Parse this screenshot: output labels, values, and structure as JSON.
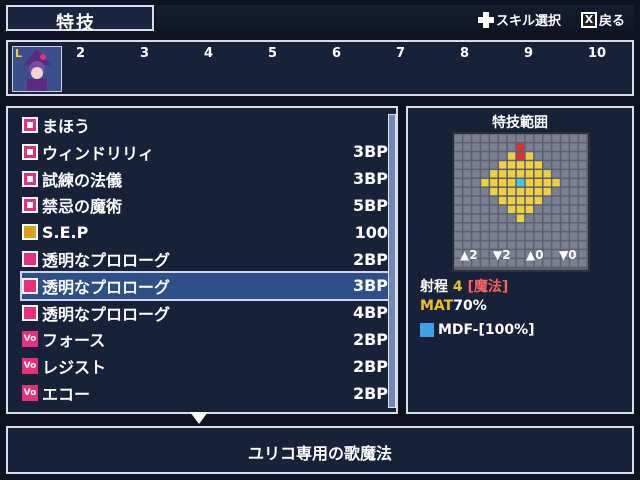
{
  "header": {
    "title": "特技",
    "hint_select": "スキル選択",
    "hint_back": "戻る",
    "hint_back_key": "X"
  },
  "party": {
    "leader_badge": "L",
    "slots": [
      "2",
      "3",
      "4",
      "5",
      "6",
      "7",
      "8",
      "9",
      "10"
    ]
  },
  "skills": [
    {
      "name": "まほう",
      "cost": "",
      "icon": "pink-square-icon"
    },
    {
      "name": "ウィンドリリィ",
      "cost": "3BP",
      "icon": "pink-square-icon"
    },
    {
      "name": "試練の法儀",
      "cost": "3BP",
      "icon": "pink-square-icon"
    },
    {
      "name": "禁忌の魔術",
      "cost": "5BP",
      "icon": "pink-square-icon"
    },
    {
      "name": "S.E.P",
      "cost": "100",
      "icon": "gold-pattern-icon"
    },
    {
      "name": "透明なプロローグ",
      "cost": "2BP",
      "icon": "music-note-icon"
    },
    {
      "name": "透明なプロローグ",
      "cost": "3BP",
      "icon": "music-note-plus-icon"
    },
    {
      "name": "透明なプロローグ",
      "cost": "4BP",
      "icon": "music-note-plus2-icon"
    },
    {
      "name": "フォース",
      "cost": "2BP",
      "icon": "vo-icon"
    },
    {
      "name": "レジスト",
      "cost": "2BP",
      "icon": "vo-icon"
    },
    {
      "name": "エコー",
      "cost": "2BP",
      "icon": "vo-icon"
    }
  ],
  "selected_index": 6,
  "detail": {
    "grid_title": "特技範囲",
    "counters": [
      "2",
      "2",
      "0",
      "0"
    ],
    "range_label": "射程",
    "range_value": "4",
    "range_type": "[魔法]",
    "mat_label": "MAT",
    "mat_value": "70%",
    "mdf_text": "MDF-[100%]"
  },
  "description": "ユリコ専用の歌魔法",
  "colors": {
    "panel_bg": "#17223a",
    "border": "#d8dde8",
    "highlight": "#2b4f86",
    "accent_pink": "#e8307a",
    "range_yellow": "#f0d040",
    "range_center": "#3fc8e8",
    "range_red": "#e03030",
    "magic_red": "#ff6060",
    "gold": "#f0c020"
  }
}
